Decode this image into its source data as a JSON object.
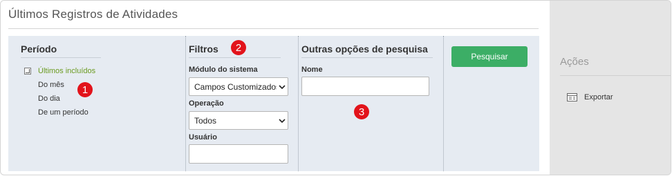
{
  "page": {
    "title": "Últimos Registros de Atividades"
  },
  "periodo": {
    "title": "Período",
    "options": [
      {
        "label": "Últimos incluídos",
        "active": true,
        "icon": "checkbox-icon"
      },
      {
        "label": "Do mês",
        "active": false
      },
      {
        "label": "Do dia",
        "active": false
      },
      {
        "label": "De um período",
        "active": false
      }
    ]
  },
  "filtros": {
    "title": "Filtros",
    "modulo": {
      "label": "Módulo do sistema",
      "value": "Campos Customizados"
    },
    "operacao": {
      "label": "Operação",
      "value": "Todos"
    },
    "usuario": {
      "label": "Usuário",
      "value": ""
    }
  },
  "outras": {
    "title": "Outras opções de pesquisa",
    "nome": {
      "label": "Nome",
      "value": ""
    }
  },
  "actions": {
    "search_label": "Pesquisar"
  },
  "side": {
    "title": "Ações",
    "items": [
      {
        "label": "Exportar",
        "icon": "export-icon"
      }
    ]
  },
  "badges": [
    "1",
    "2",
    "3"
  ],
  "colors": {
    "accent_green": "#3cae66",
    "active_link": "#6a9a1f",
    "badge_red": "#e2131b",
    "panel_bg": "#e6ebf2"
  }
}
